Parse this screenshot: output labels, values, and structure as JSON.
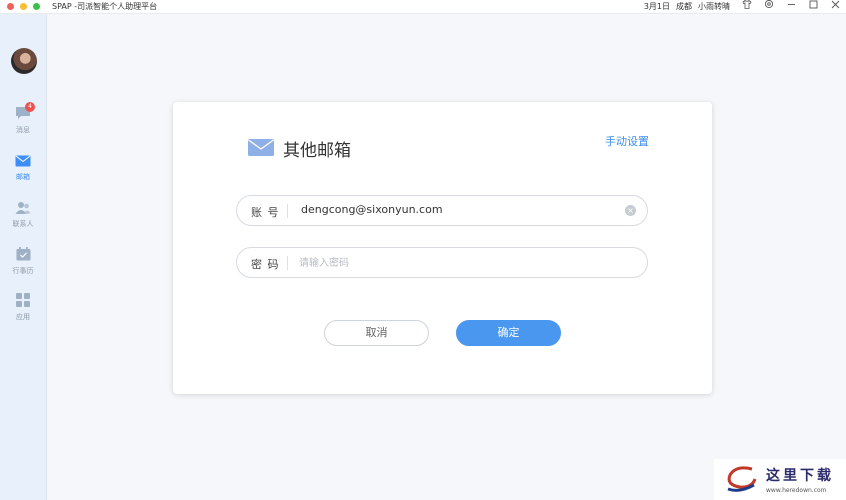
{
  "titlebar": {
    "app_title": "SPAP -司派智能个人助理平台",
    "date": "3月1日",
    "city": "成都",
    "weather": "小雨转晴",
    "icons": [
      "shirt-icon",
      "settings-icon",
      "minimize-icon",
      "maximize-icon",
      "close-icon"
    ]
  },
  "sidebar": {
    "items": [
      {
        "label": "消息",
        "icon": "message-icon",
        "badge": "4"
      },
      {
        "label": "邮箱",
        "icon": "mail-icon",
        "active": true
      },
      {
        "label": "联系人",
        "icon": "contacts-icon"
      },
      {
        "label": "行事历",
        "icon": "calendar-icon"
      },
      {
        "label": "应用",
        "icon": "apps-icon"
      }
    ]
  },
  "dialog": {
    "title": "其他邮箱",
    "manual_link": "手动设置",
    "account": {
      "label": "账 号",
      "value": "dengcong@sixonyun.com"
    },
    "password": {
      "label": "密 码",
      "placeholder": "请输入密码"
    },
    "cancel_label": "取消",
    "ok_label": "确定"
  },
  "watermark": {
    "text": "这里下载",
    "url": "www.heredown.com"
  },
  "colors": {
    "accent": "#4a97f0",
    "link": "#3b8dea",
    "sidebar_bg": "#e7f0fb",
    "badge": "#f0524f"
  }
}
